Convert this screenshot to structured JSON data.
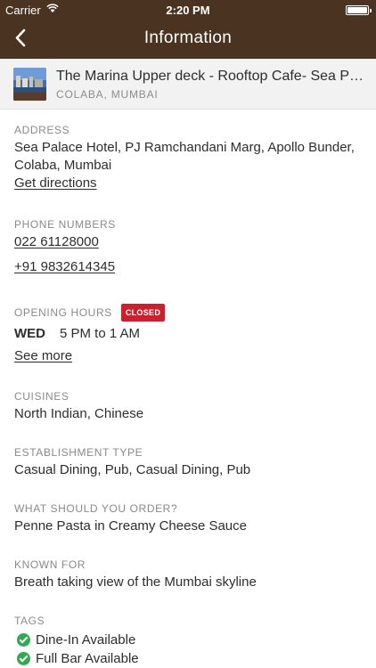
{
  "status_bar": {
    "carrier": "Carrier",
    "time": "2:20 PM"
  },
  "nav": {
    "title": "Information"
  },
  "restaurant": {
    "name": "The Marina Upper deck - Rooftop Cafe- Sea Palace Hotel",
    "locality": "COLABA, MUMBAI"
  },
  "address": {
    "label": "ADDRESS",
    "text": "Sea Palace Hotel, PJ Ramchandani Marg, Apollo Bunder, Colaba, Mumbai",
    "directions_link": "Get directions"
  },
  "phone": {
    "label": "PHONE NUMBERS",
    "numbers": [
      "022 61128000",
      "+91 9832614345"
    ]
  },
  "hours": {
    "label": "OPENING HOURS",
    "status_badge": "CLOSED",
    "day": "WED",
    "time": "5 PM to 1 AM",
    "see_more": "See more"
  },
  "cuisines": {
    "label": "CUISINES",
    "text": "North Indian, Chinese"
  },
  "establishment": {
    "label": "ESTABLISHMENT TYPE",
    "text": "Casual Dining, Pub, Casual Dining, Pub"
  },
  "order": {
    "label": "WHAT SHOULD YOU ORDER?",
    "text": "Penne Pasta in Creamy Cheese Sauce"
  },
  "known_for": {
    "label": "KNOWN FOR",
    "text": "Breath taking view of the Mumbai skyline"
  },
  "tags": {
    "label": "TAGS",
    "items": [
      "Dine-In Available",
      "Full Bar Available"
    ]
  },
  "colors": {
    "header": "#4a3321",
    "badge": "#cb202d",
    "check": "#2faa50"
  }
}
